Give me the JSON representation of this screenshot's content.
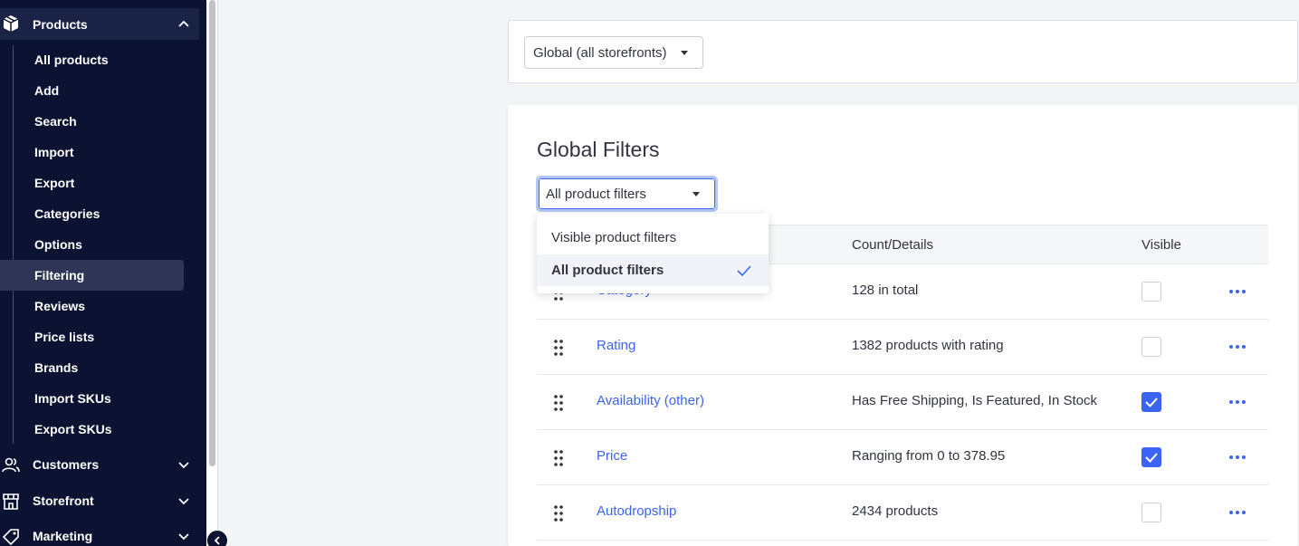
{
  "sidebar": {
    "products": {
      "label": "Products",
      "icon": "box-icon",
      "expanded": true
    },
    "sub_items": [
      {
        "label": "All products"
      },
      {
        "label": "Add"
      },
      {
        "label": "Search"
      },
      {
        "label": "Import"
      },
      {
        "label": "Export"
      },
      {
        "label": "Categories"
      },
      {
        "label": "Options"
      },
      {
        "label": "Filtering",
        "active": true
      },
      {
        "label": "Reviews"
      },
      {
        "label": "Price lists"
      },
      {
        "label": "Brands"
      },
      {
        "label": "Import SKUs"
      },
      {
        "label": "Export SKUs"
      }
    ],
    "customers": {
      "label": "Customers",
      "icon": "people-icon"
    },
    "storefront": {
      "label": "Storefront",
      "icon": "storefront-icon"
    },
    "marketing": {
      "label": "Marketing",
      "icon": "tag-icon"
    }
  },
  "storefront_select": {
    "value": "Global (all storefronts)"
  },
  "filters": {
    "title": "Global Filters",
    "select_value": "All product filters",
    "dropdown_options": [
      {
        "label": "Visible product filters",
        "selected": false
      },
      {
        "label": "All product filters",
        "selected": true
      }
    ],
    "columns": {
      "count": "Count/Details",
      "visible": "Visible"
    },
    "rows": [
      {
        "name": "Category",
        "count": "128 in total",
        "visible": false
      },
      {
        "name": "Rating",
        "count": "1382 products with rating",
        "visible": false
      },
      {
        "name": "Availability (other)",
        "count": "Has Free Shipping, Is Featured, In Stock",
        "visible": true
      },
      {
        "name": "Price",
        "count": "Ranging from 0 to 378.95",
        "visible": true
      },
      {
        "name": "Autodropship",
        "count": "2434 products",
        "visible": false
      }
    ]
  },
  "colors": {
    "sidebar_bg": "#0c1332",
    "accent": "#3c64f4",
    "text": "#313440"
  }
}
